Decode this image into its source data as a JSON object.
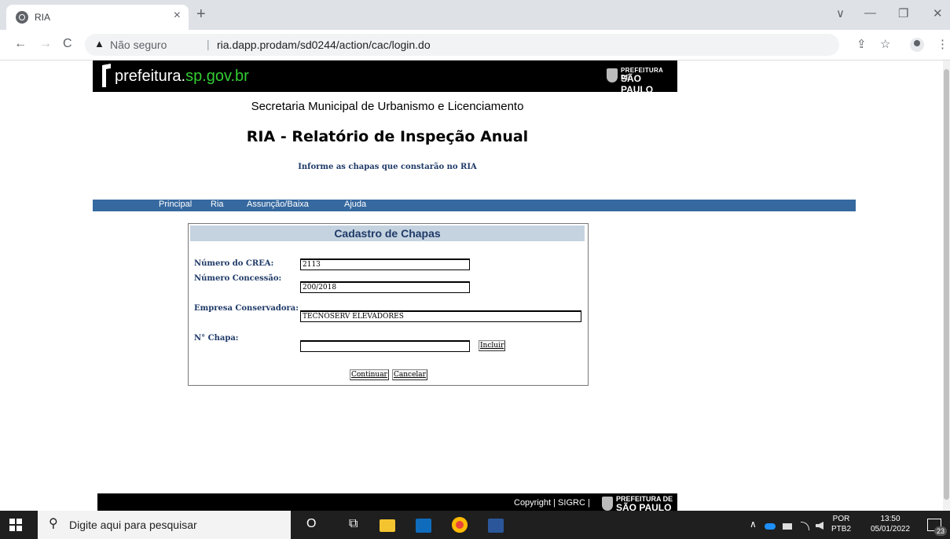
{
  "browser": {
    "tab_title": "RIA",
    "new_tab": "+",
    "tab_close": "×",
    "window_minimize": "—",
    "window_restore": "❐",
    "window_close": "✕",
    "window_menu": "∨",
    "back": "←",
    "forward": "→",
    "reload": "C",
    "security_icon": "▲",
    "security_label": "Não seguro",
    "separator": "|",
    "url": "ria.dapp.prodam/sd0244/action/cac/login.do",
    "share": "⇪",
    "bookmark": "☆",
    "menu": "⋮"
  },
  "header": {
    "logo_text_prefix": "prefeitura.",
    "logo_text_accent": "sp.gov.br",
    "badge_line1": "PREFEITURA DE",
    "badge_line2": "SÃO PAULO"
  },
  "page": {
    "secretaria": "Secretaria Municipal de Urbanismo e Licenciamento",
    "title": "RIA - Relatório de Inspeção Anual",
    "instruction": "Informe as chapas que constarão no RIA"
  },
  "menu": {
    "items": [
      {
        "label": "Principal"
      },
      {
        "label": "Ria"
      },
      {
        "label": "Assunção/Baixa"
      },
      {
        "label": "Ajuda"
      }
    ]
  },
  "form": {
    "heading": "Cadastro de Chapas",
    "crea_label": "Número do CREA:",
    "crea_value": "2113",
    "concessao_label": "Número Concessão:",
    "concessao_value": "200/2018",
    "empresa_label": "Empresa Conservadora:",
    "empresa_value": "TECNOSERV ELEVADORES",
    "chapa_label": "N° Chapa:",
    "chapa_value": "",
    "incluir_label": "Incluir",
    "continuar_label": "Continuar",
    "cancelar_label": "Cancelar"
  },
  "footer": {
    "copyright": "Copyright | SIGRC |",
    "badge_line1": "PREFEITURA DE",
    "badge_line2": "SÃO PAULO"
  },
  "taskbar": {
    "search_placeholder": "Digite aqui para pesquisar",
    "search_icon": "⚲",
    "cortana": "O",
    "taskview": "⧉",
    "tray_chevron": "∧",
    "language_line1": "POR",
    "language_line2": "PTB2",
    "time": "13:50",
    "date": "05/01/2022",
    "notification_count": "23"
  },
  "colors": {
    "menu_bar": "#3669a0",
    "panel_header": "#c5d3e0",
    "label_text": "#1f3a68",
    "logo_accent": "#33cc33"
  }
}
